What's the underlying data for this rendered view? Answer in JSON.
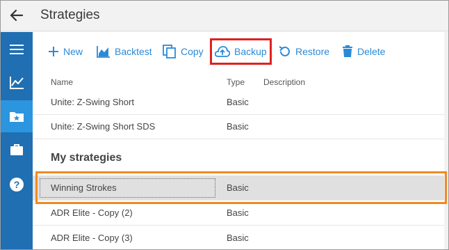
{
  "window": {
    "title": "Strategies"
  },
  "sidebar": {
    "items": [
      {
        "icon": "hamburger-menu-icon"
      },
      {
        "icon": "chart-line-icon"
      },
      {
        "icon": "folder-star-icon",
        "active": true
      },
      {
        "icon": "briefcase-icon"
      },
      {
        "icon": "help-icon"
      }
    ]
  },
  "toolbar": {
    "new_label": "New",
    "backtest_label": "Backtest",
    "copy_label": "Copy",
    "backup_label": "Backup",
    "restore_label": "Restore",
    "delete_label": "Delete"
  },
  "columns": {
    "name": "Name",
    "type": "Type",
    "description": "Description"
  },
  "rows_top": [
    {
      "name": "Unite: Z-Swing Short",
      "type": "Basic"
    },
    {
      "name": "Unite: Z-Swing Short SDS",
      "type": "Basic"
    }
  ],
  "section_title": "My strategies",
  "rows_mine": [
    {
      "name": "Winning Strokes",
      "type": "Basic",
      "selected": true
    },
    {
      "name": "ADR Elite - Copy (2)",
      "type": "Basic"
    },
    {
      "name": "ADR Elite - Copy (3)",
      "type": "Basic"
    }
  ],
  "colors": {
    "accent": "#2a8ad8",
    "sidebar": "#1f6fb2",
    "sidebar_active": "#2c95e0",
    "highlight_red": "#e02020",
    "highlight_orange": "#f08a24"
  }
}
